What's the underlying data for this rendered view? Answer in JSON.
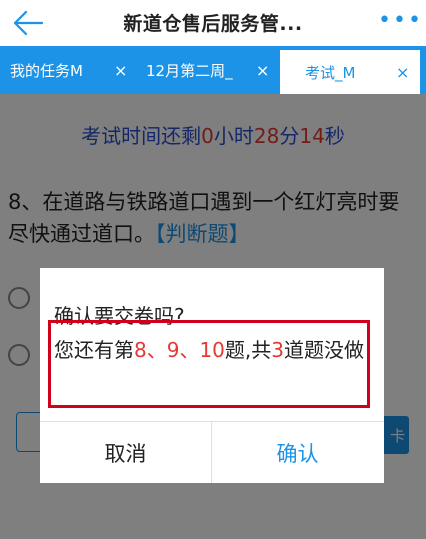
{
  "header": {
    "title": "新道仓售后服务管...",
    "more_label": "•••"
  },
  "tabs": [
    {
      "label": "我的任务M",
      "close": "×"
    },
    {
      "label": "12月第二周_",
      "close": "×"
    },
    {
      "label": "考试_M",
      "close": "×"
    }
  ],
  "timer": {
    "prefix": "考试时间还剩",
    "hours": "0",
    "hours_unit": "小时",
    "minutes": "28",
    "minutes_unit": "分",
    "seconds": "14",
    "seconds_unit": "秒"
  },
  "question": {
    "text": "8、在道路与铁路道口遇到一个红灯亮时要尽快通过道口。",
    "type": "【判断题】"
  },
  "side_button_label": "卡",
  "dialog": {
    "title": "确认要交卷吗?",
    "msg_prefix": "您还有第",
    "missing_list": "8、9、10",
    "msg_mid": "题,共",
    "missing_count": "3",
    "msg_suffix": "道题没做",
    "cancel_label": "取消",
    "confirm_label": "确认"
  },
  "colors": {
    "accent": "#1d93e8",
    "highlight_box": "#d0021b",
    "number_red": "#e53935"
  }
}
